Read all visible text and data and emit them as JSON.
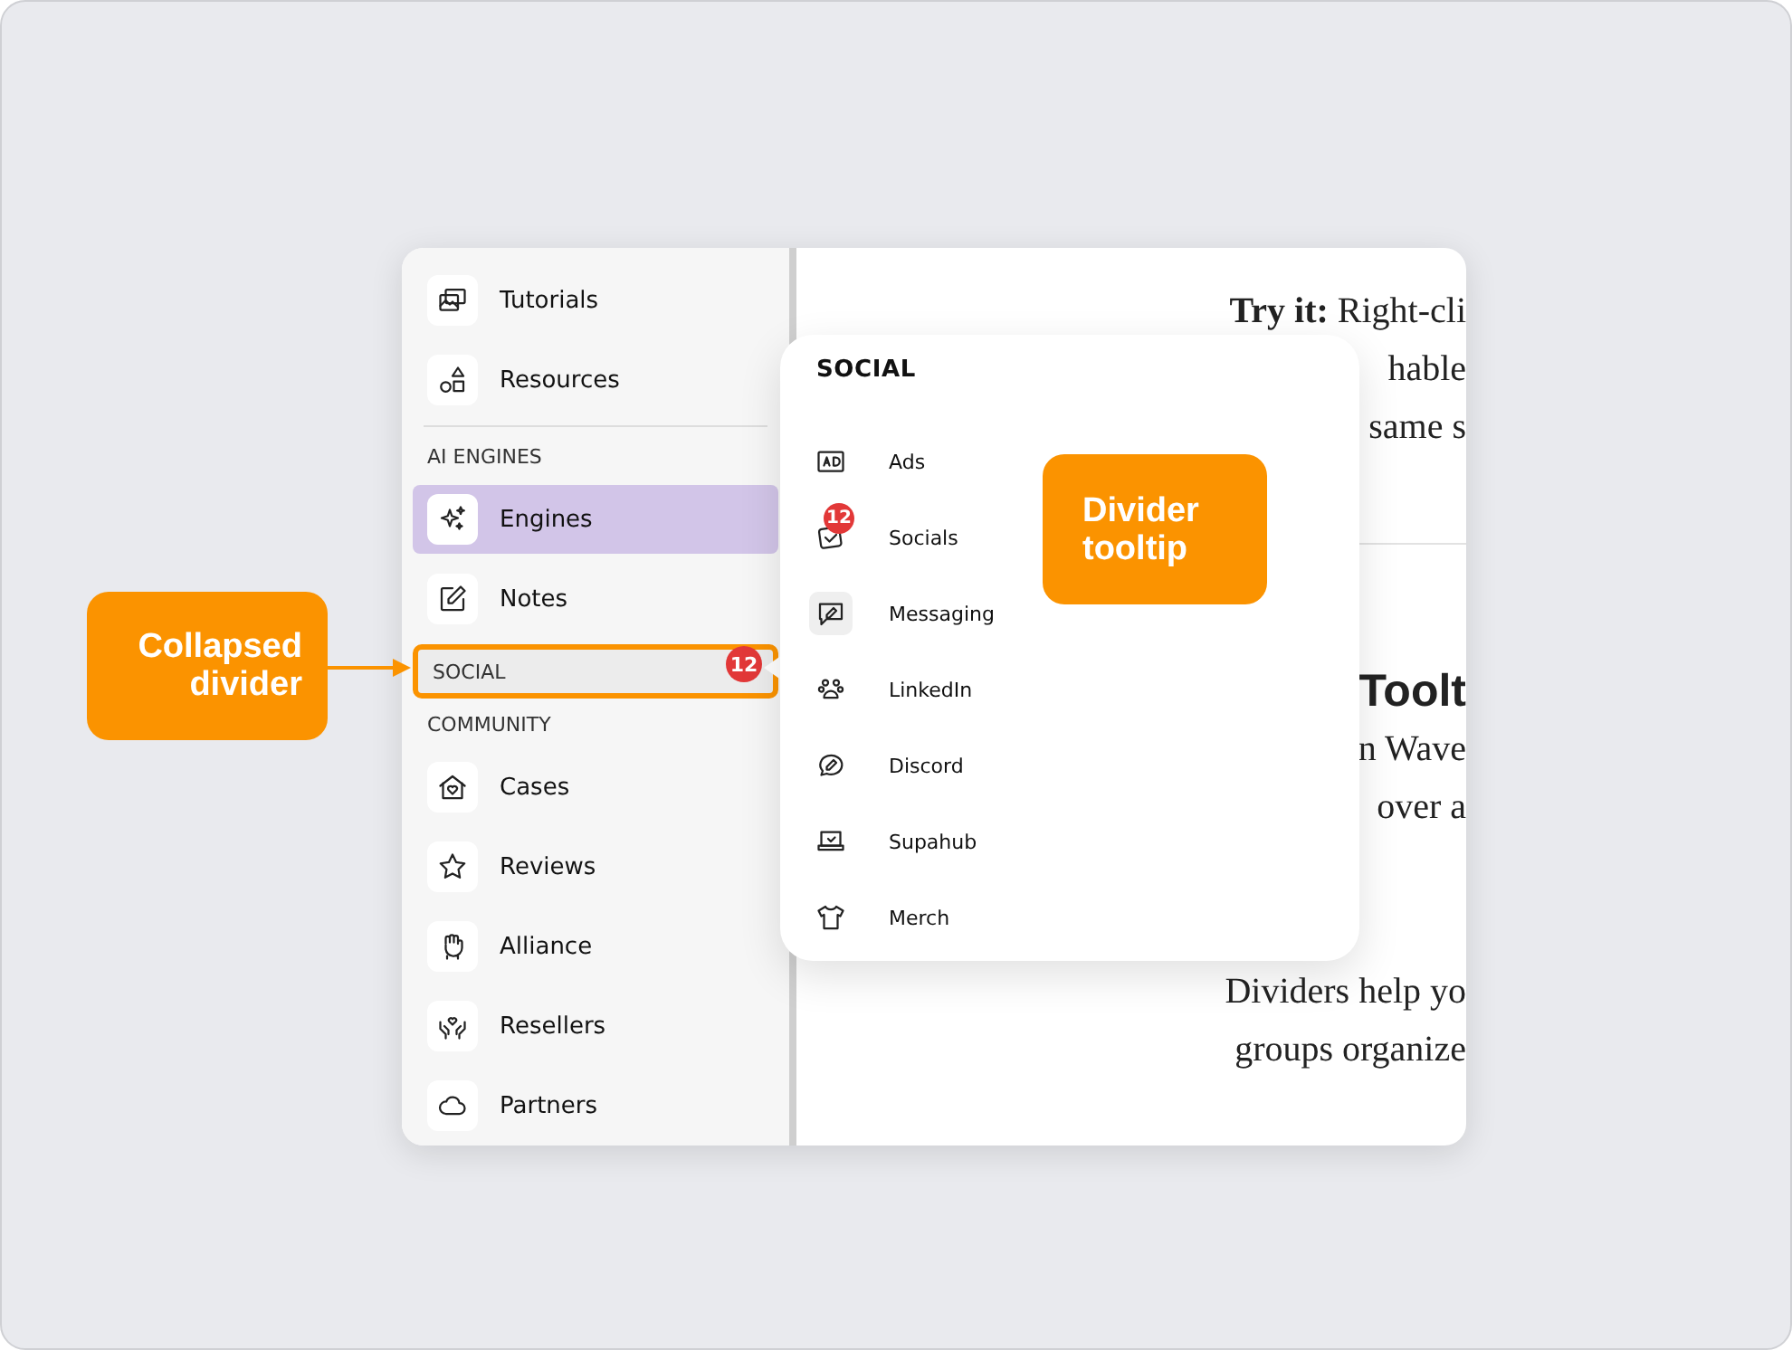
{
  "sidebar": {
    "entries": [
      {
        "kind": "item",
        "label": "Tutorials",
        "selected": false
      },
      {
        "kind": "item",
        "label": "Resources",
        "selected": false
      },
      {
        "kind": "divider"
      },
      {
        "kind": "header",
        "label": "AI ENGINES"
      },
      {
        "kind": "item",
        "label": "Engines",
        "selected": true
      },
      {
        "kind": "item",
        "label": "Notes",
        "selected": false
      },
      {
        "kind": "collapsed",
        "label": "SOCIAL",
        "badge": "12",
        "highlighted": true
      },
      {
        "kind": "header",
        "label": "COMMUNITY"
      },
      {
        "kind": "item",
        "label": "Cases",
        "selected": false
      },
      {
        "kind": "item",
        "label": "Reviews",
        "selected": false
      },
      {
        "kind": "item",
        "label": "Alliance",
        "selected": false
      },
      {
        "kind": "item",
        "label": "Resellers",
        "selected": false
      },
      {
        "kind": "item",
        "label": "Partners",
        "selected": false
      }
    ]
  },
  "content": {
    "intro_lines": [
      "**Try it:** Right-cli",
      "hable",
      "same s"
    ],
    "heading": "Toolt",
    "body_lines": [
      "n Wave",
      "over a"
    ],
    "closing_lines": [
      "Dividers help yo",
      "groups organize"
    ]
  },
  "tooltip": {
    "title": "SOCIAL",
    "items": [
      {
        "label": "Ads",
        "highlighted": false
      },
      {
        "label": "Socials",
        "badge": "12",
        "highlighted": false
      },
      {
        "label": "Messaging",
        "highlighted": true
      },
      {
        "label": "LinkedIn",
        "highlighted": false
      },
      {
        "label": "Discord",
        "highlighted": false
      },
      {
        "label": "Supahub",
        "highlighted": false
      },
      {
        "label": "Merch",
        "highlighted": false
      }
    ]
  },
  "callouts": [
    {
      "kind": "left",
      "text": "Collapsed divider"
    },
    {
      "kind": "right",
      "text": "Divider tooltip"
    }
  ]
}
